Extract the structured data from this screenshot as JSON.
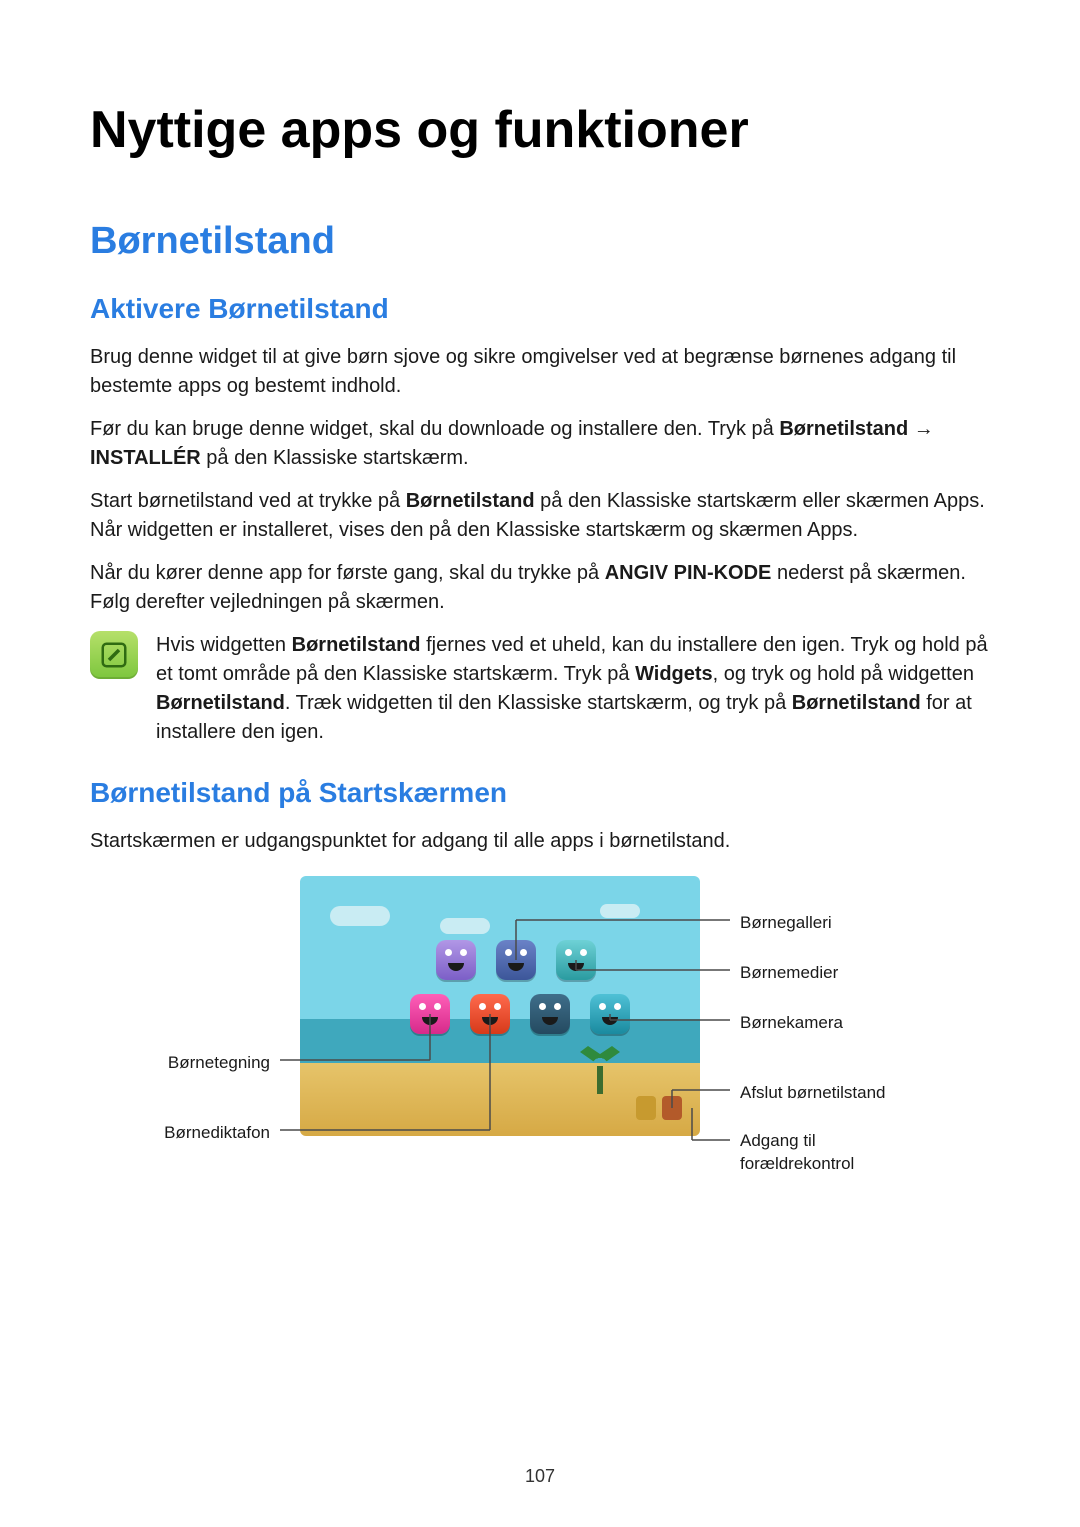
{
  "page": {
    "title": "Nyttige apps og funktioner",
    "number": "107"
  },
  "h2_1": "Børnetilstand",
  "sec1": {
    "heading": "Aktivere Børnetilstand",
    "p1": "Brug denne widget til at give børn sjove og sikre omgivelser ved at begrænse børnenes adgang til bestemte apps og bestemt indhold.",
    "p2_a": "Før du kan bruge denne widget, skal du downloade og installere den. Tryk på ",
    "p2_b1": "Børnetilstand",
    "p2_arrow": " → ",
    "p2_b2": "INSTALLÉR",
    "p2_c": " på den Klassiske startskærm.",
    "p3_a": "Start børnetilstand ved at trykke på ",
    "p3_b": "Børnetilstand",
    "p3_c": " på den Klassiske startskærm eller skærmen Apps. Når widgetten er installeret, vises den på den Klassiske startskærm og skærmen Apps.",
    "p4_a": "Når du kører denne app for første gang, skal du trykke på ",
    "p4_b": "ANGIV PIN-KODE",
    "p4_c": " nederst på skærmen. Følg derefter vejledningen på skærmen.",
    "note_a": "Hvis widgetten ",
    "note_b1": "Børnetilstand",
    "note_c": " fjernes ved et uheld, kan du installere den igen. Tryk og hold på et tomt område på den Klassiske startskærm. Tryk på ",
    "note_b2": "Widgets",
    "note_d": ", og tryk og hold på widgetten ",
    "note_b3": "Børnetilstand",
    "note_e": ". Træk widgetten til den Klassiske startskærm, og tryk på ",
    "note_b4": "Børnetilstand",
    "note_f": " for at installere den igen."
  },
  "sec2": {
    "heading": "Børnetilstand på Startskærmen",
    "p1": "Startskærmen er udgangspunktet for adgang til alle apps i børnetilstand."
  },
  "labels": {
    "gallery": "Børnegalleri",
    "media": "Børnemedier",
    "camera": "Børnekamera",
    "exit": "Afslut børnetilstand",
    "parental_l1": "Adgang til",
    "parental_l2": "forældrekontrol",
    "drawing": "Børnetegning",
    "voice": "Børnediktafon"
  }
}
